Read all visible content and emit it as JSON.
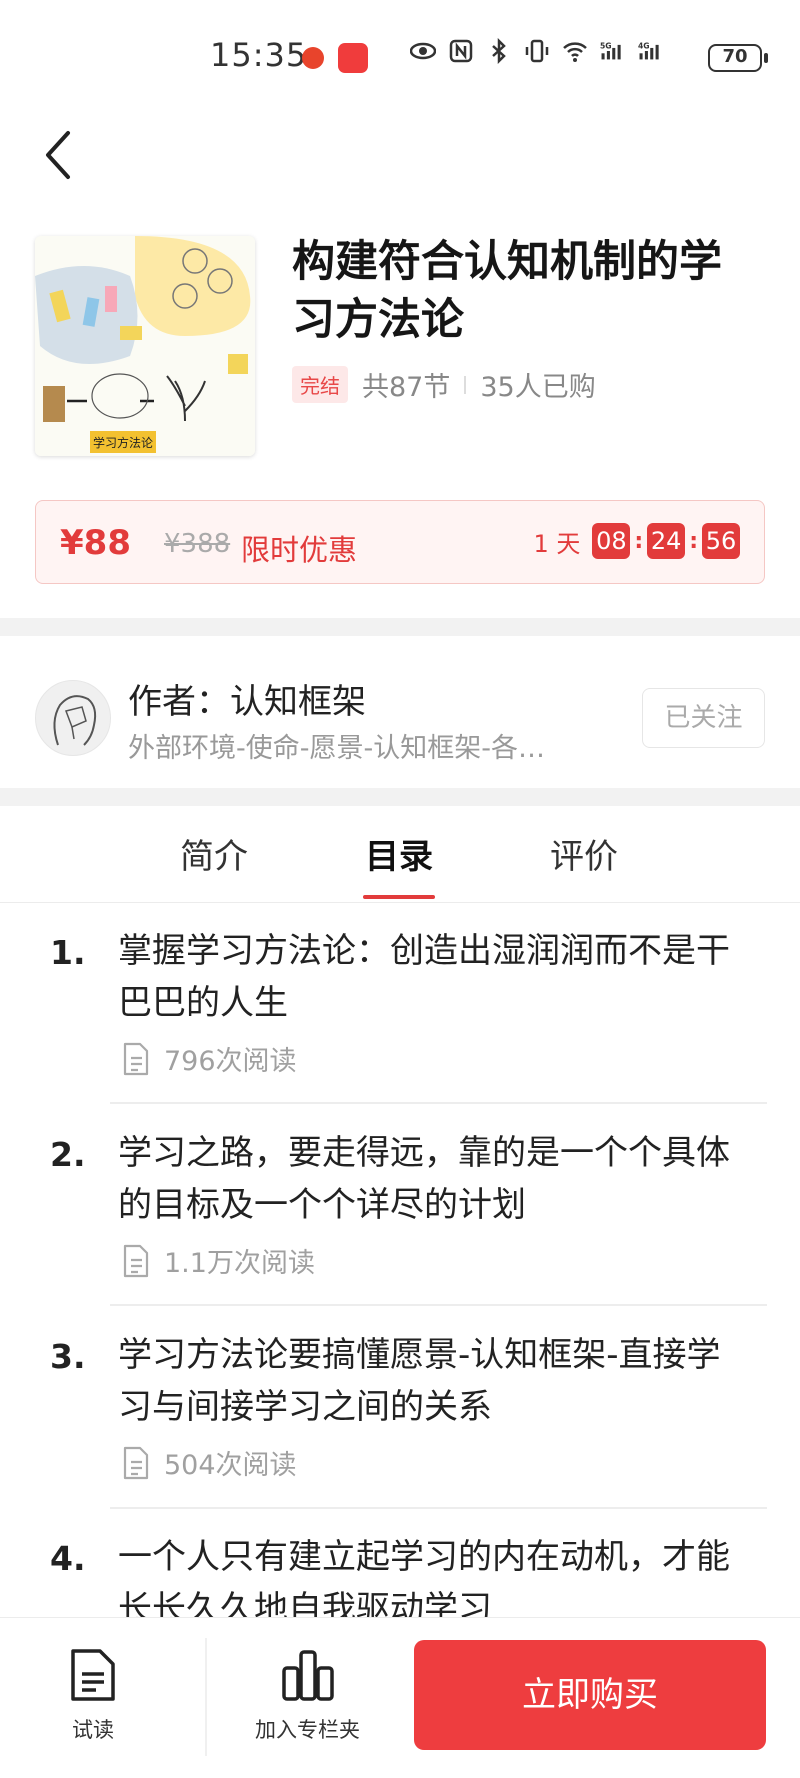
{
  "status_bar": {
    "time": "15:35",
    "icons": [
      "huawei-app-icon",
      "eye-icon",
      "nfc-icon",
      "bluetooth-icon",
      "vibrate-icon",
      "wifi-icon",
      "signal-5g-icon",
      "signal-4g-icon"
    ],
    "network_5g": "5G",
    "network_4g": "4G",
    "battery": "70"
  },
  "course": {
    "title": "构建符合认知机制的学习方法论",
    "status_badge": "完结",
    "sections": "共87节",
    "purchases": "35人已购",
    "cover_caption": "学习方法论"
  },
  "price": {
    "current": "¥88",
    "original": "¥388",
    "promo_label": "限时优惠",
    "countdown_days": "1 天",
    "countdown_hours": "08",
    "countdown_minutes": "24",
    "countdown_seconds": "56"
  },
  "author": {
    "name": "作者：认知框架",
    "description": "外部环境-使命-愿景-认知框架-各…",
    "follow_label": "已关注"
  },
  "tabs": [
    {
      "label": "简介",
      "active": false
    },
    {
      "label": "目录",
      "active": true
    },
    {
      "label": "评价",
      "active": false
    }
  ],
  "toc": [
    {
      "num": "1.",
      "title": "掌握学习方法论：创造出湿润润而不是干巴巴的人生",
      "reads": "796次阅读"
    },
    {
      "num": "2.",
      "title": "学习之路，要走得远，靠的是一个个具体的目标及一个个详尽的计划",
      "reads": "1.1万次阅读"
    },
    {
      "num": "3.",
      "title": "学习方法论要搞懂愿景-认知框架-直接学习与间接学习之间的关系",
      "reads": "504次阅读"
    },
    {
      "num": "4.",
      "title": "一个人只有建立起学习的内在动机，才能长长久久地自我驱动学习",
      "reads": ""
    }
  ],
  "bottom_bar": {
    "trial_label": "试读",
    "add_label": "加入专栏夹",
    "buy_label": "立即购买"
  },
  "colors": {
    "accent": "#e23b3b",
    "buy_button": "#ee3d3f",
    "price_bg": "#fff4f3"
  }
}
